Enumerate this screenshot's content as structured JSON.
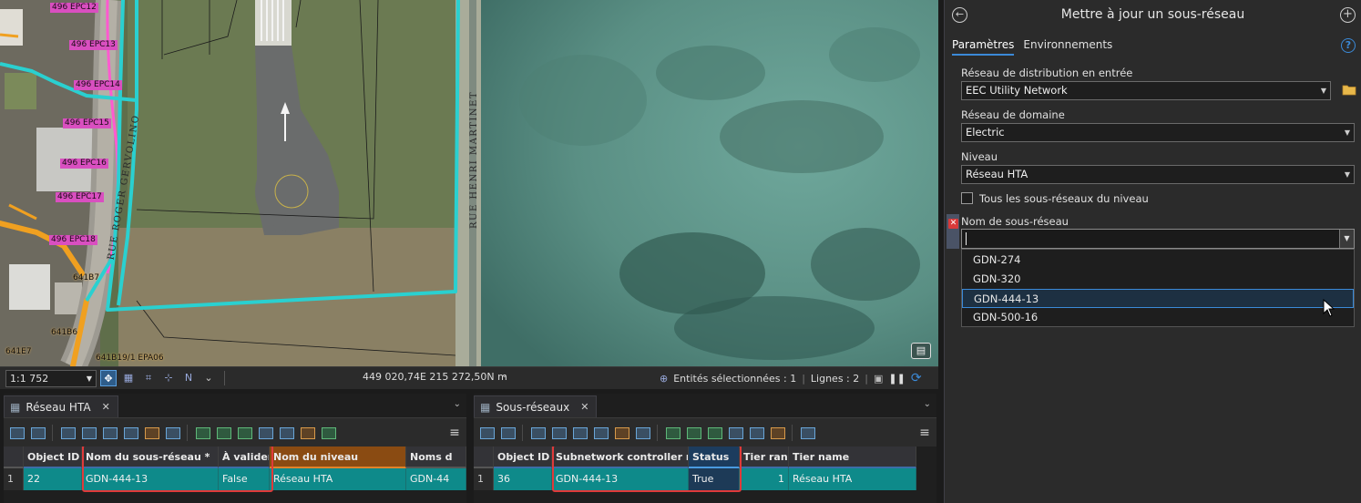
{
  "map": {
    "parcel_labels": [
      "496 EPC12",
      "496 EPC13",
      "496 EPC14",
      "496 EPC15",
      "496 EPC16",
      "496 EPC17",
      "496 EPC18"
    ],
    "feature_labels": [
      "641B7",
      "641B6",
      "641E7",
      "641B19/1 EPA06"
    ],
    "streets": [
      "RUE ROGER GERVOLINO",
      "RUE HENRI MARTINET"
    ],
    "basemap_icon": "layers-icon"
  },
  "status_bar": {
    "scale": "1:1 752",
    "coordinates": "449 020,74E 215 272,50N m",
    "selected_label": "Entités sélectionnées : 1",
    "lines_label": "Lignes : 2"
  },
  "left_table": {
    "tab": "Réseau HTA",
    "columns": [
      "Object ID *",
      "Nom du sous-réseau *",
      "À valider",
      "Nom du niveau",
      "Noms d"
    ],
    "row": {
      "rn": "1",
      "object_id": "22",
      "subnetwork": "GDN-444-13",
      "to_validate": "False",
      "tier": "Réseau HTA",
      "names": "GDN-44"
    }
  },
  "right_table": {
    "tab": "Sous-réseaux",
    "columns": [
      "Object ID *",
      "Subnetwork controller n...",
      "Status",
      "Tier rank",
      "Tier name"
    ],
    "row": {
      "rn": "1",
      "object_id": "36",
      "controller": "GDN-444-13",
      "status": "True",
      "tier_rank": "1",
      "tier_name": "Réseau HTA"
    }
  },
  "gp": {
    "title": "Mettre à jour un sous-réseau",
    "tabs": [
      "Paramètres",
      "Environnements"
    ],
    "input_network_label": "Réseau de distribution en entrée",
    "input_network_value": "EEC Utility Network",
    "domain_label": "Réseau de domaine",
    "domain_value": "Electric",
    "tier_label": "Niveau",
    "tier_value": "Réseau HTA",
    "all_subnetworks_label": "Tous les sous-réseaux du niveau",
    "subnetwork_name_label": "Nom de sous-réseau",
    "error_icon_glyph": "✕",
    "dropdown_items": [
      "GDN-274",
      "GDN-320",
      "GDN-444-13",
      "GDN-500-16"
    ]
  },
  "colors": {
    "accent": "#3b8ad8",
    "teal_row": "#0e8a8a",
    "highlight": "#e03a3a",
    "network_line": "#2ad0d0",
    "parcel": "#d94fc0",
    "orange_line": "#f0a020"
  }
}
